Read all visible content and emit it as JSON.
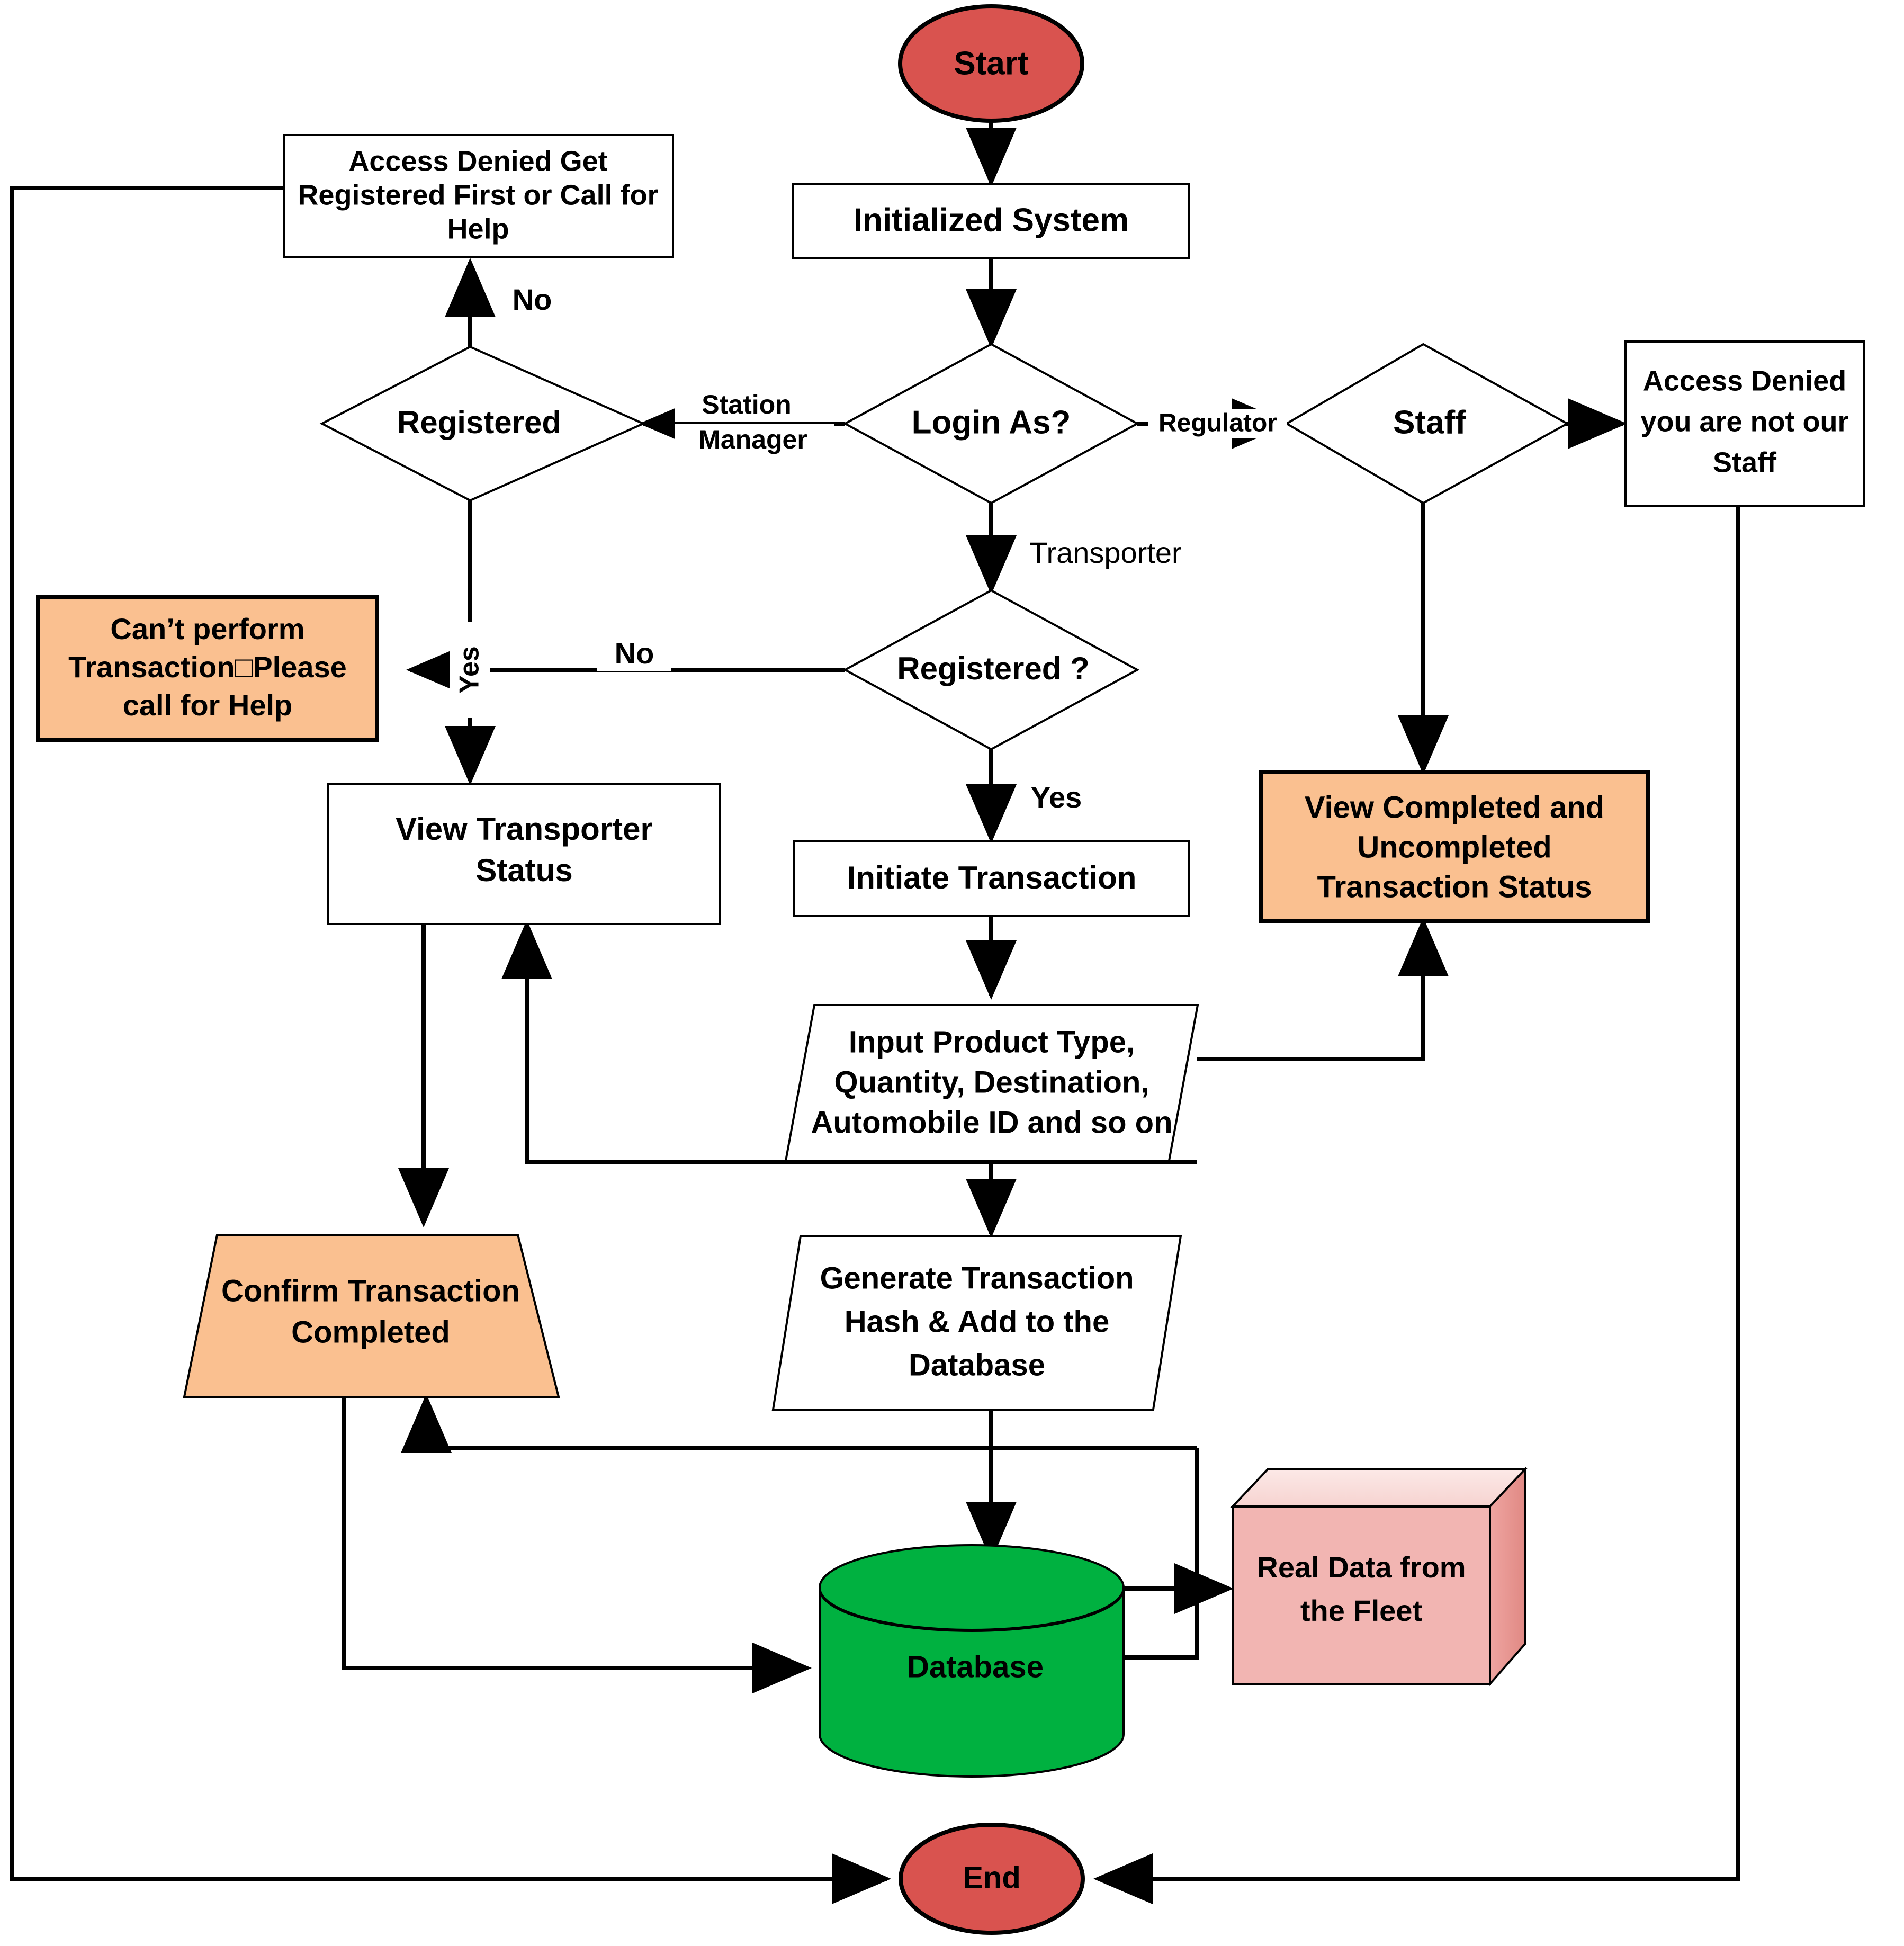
{
  "diagram": {
    "title": "Transporter / Station Manager / Regulator transaction flowchart",
    "colors": {
      "terminator_fill": "#D9534F",
      "process_fill": "#FFFFFF",
      "highlight_fill": "#FAC090",
      "database_fill": "#00B140",
      "cube_front_fill": "#F2B5B2",
      "cube_top_fill": "#F9DCDA",
      "cube_side_fill": "#E8928E",
      "stroke": "#000000",
      "background": "#FFFFFF"
    }
  },
  "nodes": {
    "start": {
      "label": "Start",
      "shape": "ellipse"
    },
    "init_system": {
      "label": "Initialized System",
      "shape": "rect"
    },
    "login_as": {
      "label": "Login As?",
      "shape": "diamond"
    },
    "registered_sm": {
      "label": "Registered",
      "shape": "diamond"
    },
    "access_denied_register": {
      "line1": "Access Denied Get",
      "line2": "Registered First or Call for",
      "line3": "Help",
      "shape": "rect"
    },
    "staff": {
      "label": "Staff",
      "shape": "diamond"
    },
    "access_denied_staff": {
      "line1": "Access Denied",
      "line2": "you are not our",
      "line3": "Staff",
      "shape": "rect"
    },
    "registered_transporter": {
      "label": "Registered ?",
      "shape": "diamond"
    },
    "cant_perform": {
      "line1": "Can’t perform",
      "line2": "Transaction□Please",
      "line3": "call for Help",
      "shape": "rect-highlight"
    },
    "view_transporter_status": {
      "line1": "View Transporter",
      "line2": "Status",
      "shape": "rect"
    },
    "initiate_transaction": {
      "label": "Initiate Transaction",
      "shape": "rect"
    },
    "view_completed": {
      "line1": "View Completed and",
      "line2": "Uncompleted",
      "line3": "Transaction Status",
      "shape": "rect-highlight"
    },
    "input_product": {
      "line1": "Input Product Type,",
      "line2": "Quantity, Destination,",
      "line3": "Automobile ID and so on",
      "shape": "parallelogram"
    },
    "confirm_transaction": {
      "line1": "Confirm Transaction",
      "line2": "Completed",
      "shape": "trapezoid-highlight"
    },
    "generate_hash": {
      "line1": "Generate Transaction",
      "line2": "Hash & Add to the",
      "line3": "Database",
      "shape": "parallelogram"
    },
    "database": {
      "label": "Database",
      "shape": "cylinder"
    },
    "real_data": {
      "line1": "Real Data from",
      "line2": "the Fleet",
      "shape": "cube"
    },
    "end": {
      "label": "End",
      "shape": "ellipse"
    }
  },
  "edge_labels": {
    "station_manager_l1": "Station",
    "station_manager_l2": "Manager",
    "regulator": "Regulator",
    "transporter": "Transporter",
    "registered_sm_no": "No",
    "registered_sm_yes": "Yes",
    "registered_transporter_no": "No",
    "registered_transporter_yes": "Yes"
  }
}
